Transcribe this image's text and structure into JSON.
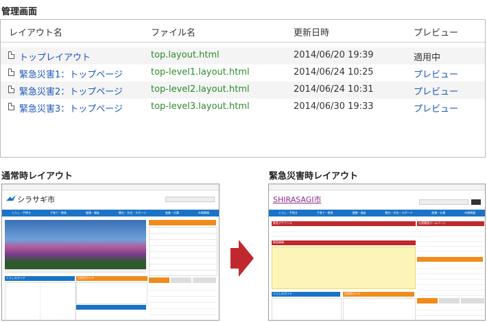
{
  "admin": {
    "title": "管理画面",
    "columns": [
      "レイアウト名",
      "ファイル名",
      "更新日時",
      "プレビュー"
    ],
    "rows": [
      {
        "name": "トップレイアウト",
        "file": "top.layout.html",
        "date": "2014/06/20 19:39",
        "preview": "適用中"
      },
      {
        "name": "緊急災害1：トップページ",
        "file": "top-level1.layout.html",
        "date": "2014/06/24 10:25",
        "preview": "プレビュー"
      },
      {
        "name": "緊急災害2：トップページ",
        "file": "top-level2.layout.html",
        "date": "2014/06/24 10:31",
        "preview": "プレビュー"
      },
      {
        "name": "緊急災害3：トップページ",
        "file": "top-level3.layout.html",
        "date": "2014/06/30 19:33",
        "preview": "プレビュー"
      }
    ]
  },
  "normal": {
    "title": "通常時レイアウト",
    "site_name": "シラサギ市",
    "nav": [
      "くらし・手続き",
      "子育て・教育",
      "健康・福祉",
      "観光・文化・スポーツ",
      "産業・仕事",
      "市政情報"
    ],
    "sidebar_heading": "くらしのガイド",
    "guide_heading": "目的別ガイド"
  },
  "emergency": {
    "title": "緊急災害時レイアウト",
    "site_name": "SHIRASAGI市",
    "nav": [
      "くらし・手続き",
      "子育て・教育",
      "健康・福祉",
      "観光・文化・スポーツ",
      "産業・仕事",
      "市政情報"
    ],
    "notice_heading": "緊急アナウンス",
    "info_heading": "緊急情報",
    "links_heading": "災害関連ホームページ",
    "sidebar_heading": "くらしのガイド",
    "guide_heading": "目的別ガイド"
  },
  "colors": {
    "accent_blue": "#1a73c7",
    "orange": "#f08c1c",
    "alert_red": "#c0282d",
    "link_blue": "#1a55b8",
    "file_green": "#2c8a2c"
  }
}
